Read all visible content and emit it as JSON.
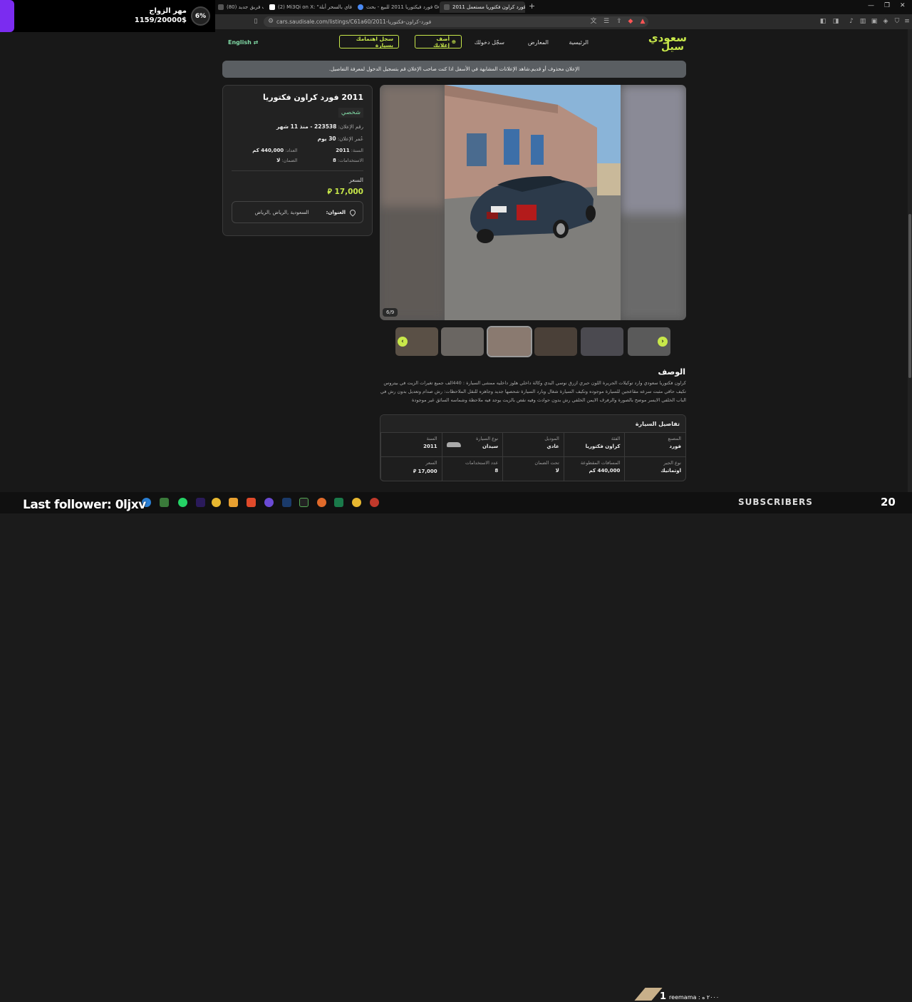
{
  "browser": {
    "tabs": [
      {
        "label": "(80) دخلت فريق جديد"
      },
      {
        "label": "(2) Mi3Qi on X: \"ر لنا فاي بالسحر أبلة\""
      },
      {
        "label": "فورد فيكتوريا 2011 للبيع - بحث Google"
      },
      {
        "label": "2011 فورد كراون فكتوريا مستعمل"
      }
    ],
    "url": "cars.saudisale.com/listings/C61a60/2011-فورد-كراون-فكتوريا"
  },
  "stream_overlay": {
    "goal_title": "مهر الزواج",
    "goal_amount": "1159/20000$",
    "goal_percent": "6%",
    "last_follower": "Last follower: 0ljxv",
    "subscribers_label": "SUBSCRIBERS",
    "subscribers_count": "20",
    "donor_number": "1",
    "donor_text": "reemama : ٢٠٠٠ ه"
  },
  "site": {
    "logo_line1": "سعودي",
    "logo_line2": "سيل",
    "nav": {
      "home": "الرئيسية",
      "showrooms": "المعارض",
      "login": "سجّل دخولك"
    },
    "add_listing": "أضف إعلانك",
    "register_interest": "سجل اهتمامك بسيارة",
    "language": "English",
    "notice": "الإعلان محذوف أو قديم.شاهد الإعلانات المشابهة في الأسفل اذا كنت صاحب الإعلان قم بتسجيل الدخول لمعرفة التفاصيل."
  },
  "listing": {
    "title": "2011 فورد كراون فكتوريا",
    "seller_type": "شخصي",
    "ad_number_label": "رقم الإعلان:",
    "ad_number_value": "223538 - منذ 11 شهر",
    "ad_age_label": "عُمر الإعلان:",
    "ad_age_value": "30 يوم",
    "year_label": "السنة:",
    "year_value": "2011",
    "mileage_label": "العداد:",
    "mileage_value": "440,000 كم",
    "owners_label": "الاستخدامات:",
    "owners_value": "8",
    "warranty_label": "الضمان:",
    "warranty_value": "لا",
    "price_label": "السعر",
    "price_value": "17,000",
    "address_label": "العنوان:",
    "address_value": "السعودية ,الرياض ,الرياض",
    "image_counter": "6/9"
  },
  "description": {
    "heading": "الوصف",
    "text": "كراون فكتوريا سعودي وارد توكيلات الجريرة اللون حبري ازرق نوسي البدي وكالة داخلي هلوز داخليه ممشى السيارة : 440الف جميع تغيرات الزيت في بيتروس تكيف حاقي مثبت سرعه مقاعجين للسيارة موجوده وتكيف السيارة شغال وبارد السيارة شحصها جديد وجاهزه للنقل الملاحظات: رش صدام وتعديل بدون رش في الباب الخلفي الايسر موضح بالصورة والرفرف الايمن الخلفي رش بدون حوادث وفيه نقص بالزيت يوجد فيه ملاحظة وشماسه السائق غير موجودة"
  },
  "details": {
    "heading": "تفاصيل السيارة",
    "cells": [
      {
        "label": "المصنع",
        "value": "فورد"
      },
      {
        "label": "الفئة",
        "value": "كراون فكتوريا"
      },
      {
        "label": "الموديل",
        "value": "عادي"
      },
      {
        "label": "نوع السيارة",
        "value": "سيدان"
      },
      {
        "label": "السنة",
        "value": "2011"
      },
      {
        "label": "نوع الجير",
        "value": "اوتماتيك"
      },
      {
        "label": "المسافات المقطوعة",
        "value": "440,000 كم"
      },
      {
        "label": "تحت الضمان",
        "value": "لا"
      },
      {
        "label": "عدد الاستخدامات",
        "value": "8"
      },
      {
        "label": "السعر",
        "value": "17,000"
      }
    ]
  },
  "colors": {
    "accent": "#c8e84a",
    "green_text": "#7fd8a4",
    "stream_purple": "#7b2cf0"
  }
}
